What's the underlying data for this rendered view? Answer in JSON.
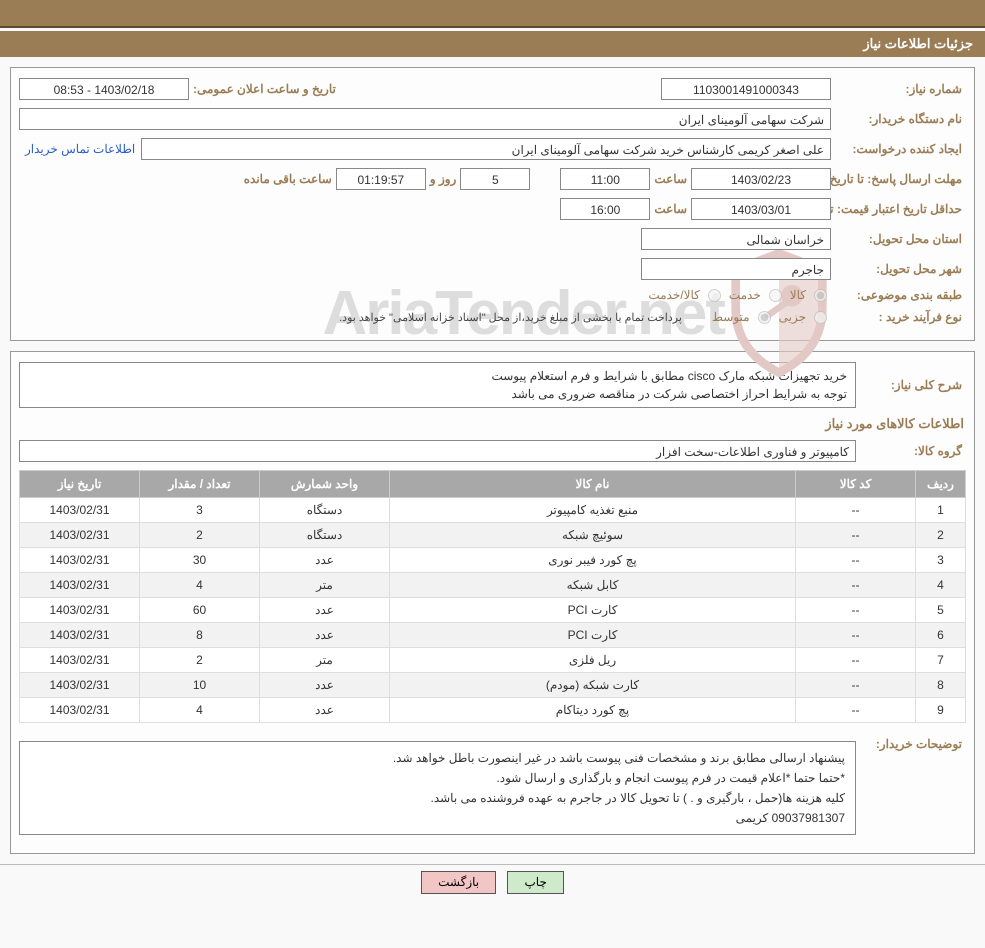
{
  "titlebar": "جزئیات اطلاعات نیاز",
  "labels": {
    "need_no": "شماره نیاز:",
    "announce_dt": "تاریخ و ساعت اعلان عمومی:",
    "org_name": "نام دستگاه خریدار:",
    "requester": "ایجاد کننده درخواست:",
    "buyer_contact": "اطلاعات تماس خریدار",
    "deadline": "مهلت ارسال پاسخ:",
    "to_date": "تا تاریخ:",
    "hour": "ساعت",
    "days_and": "روز و",
    "remaining": "ساعت باقی مانده",
    "min_validity": "حداقل تاریخ اعتبار قیمت:",
    "province": "استان محل تحویل:",
    "city": "شهر محل تحویل:",
    "category": "طبقه بندی موضوعی:",
    "cat_goods": "کالا",
    "cat_service": "خدمت",
    "cat_both": "کالا/خدمت",
    "purchase_type": "نوع فرآیند خرید :",
    "pt_minor": "جزیی",
    "pt_medium": "متوسط",
    "payment_note": "پرداخت تمام یا بخشی از مبلغ خرید،از محل \"اسناد خزانه اسلامی\" خواهد بود.",
    "need_summary": "شرح کلی نیاز:",
    "goods_info": "اطلاعات کالاهای مورد نیاز",
    "goods_group": "گروه کالا:",
    "buyer_notes_lbl": "توضیحات خریدار:"
  },
  "values": {
    "need_no": "1103001491000343",
    "announce_dt": "1403/02/18 - 08:53",
    "org_name": "شرکت سهامی آلومینای ایران",
    "requester": "علی اصغر کریمی کارشناس خرید شرکت سهامی آلومینای ایران",
    "deadline_date": "1403/02/23",
    "deadline_time": "11:00",
    "days_left": "5",
    "time_left": "01:19:57",
    "validity_date": "1403/03/01",
    "validity_time": "16:00",
    "province": "خراسان شمالی",
    "city": "جاجرم",
    "goods_group": "کامپیوتر و فناوری اطلاعات-سخت افزار"
  },
  "need_summary": [
    "خرید تجهیزات شبکه مارک cisco مطابق با شرایط و فرم استعلام پیوست",
    "توجه به شرایط احراز اختصاصی شرکت در مناقصه ضروری می باشد"
  ],
  "table": {
    "headers": [
      "ردیف",
      "کد کالا",
      "نام کالا",
      "واحد شمارش",
      "تعداد / مقدار",
      "تاریخ نیاز"
    ],
    "rows": [
      {
        "idx": "1",
        "code": "--",
        "name": "منبع تغذیه کامپیوتر",
        "unit": "دستگاه",
        "qty": "3",
        "date": "1403/02/31"
      },
      {
        "idx": "2",
        "code": "--",
        "name": "سوئیچ شبکه",
        "unit": "دستگاه",
        "qty": "2",
        "date": "1403/02/31"
      },
      {
        "idx": "3",
        "code": "--",
        "name": "پچ کورد فیبر نوری",
        "unit": "عدد",
        "qty": "30",
        "date": "1403/02/31"
      },
      {
        "idx": "4",
        "code": "--",
        "name": "کابل شبکه",
        "unit": "متر",
        "qty": "4",
        "date": "1403/02/31"
      },
      {
        "idx": "5",
        "code": "--",
        "name": "کارت PCI",
        "unit": "عدد",
        "qty": "60",
        "date": "1403/02/31"
      },
      {
        "idx": "6",
        "code": "--",
        "name": "کارت PCI",
        "unit": "عدد",
        "qty": "8",
        "date": "1403/02/31"
      },
      {
        "idx": "7",
        "code": "--",
        "name": "ریل فلزی",
        "unit": "متر",
        "qty": "2",
        "date": "1403/02/31"
      },
      {
        "idx": "8",
        "code": "--",
        "name": "کارت شبکه (مودم)",
        "unit": "عدد",
        "qty": "10",
        "date": "1403/02/31"
      },
      {
        "idx": "9",
        "code": "--",
        "name": "پچ کورد دیتاکام",
        "unit": "عدد",
        "qty": "4",
        "date": "1403/02/31"
      }
    ]
  },
  "buyer_notes": [
    "پیشنهاد ارسالی مطابق برند و مشخصات فنی پیوست باشد در غیر اینصورت باطل خواهد شد.",
    "*حتما حتما *اعلام قیمت در فرم پیوست انجام و بارگذاری و ارسال شود.",
    "کلیه هزینه ها(حمل ، بارگیری و . ) تا تحویل کالا در جاجرم به عهده فروشنده می باشد.",
    "09037981307 کریمی"
  ],
  "buttons": {
    "print": "چاپ",
    "back": "بازگشت"
  },
  "watermark": "AriaTender.net"
}
